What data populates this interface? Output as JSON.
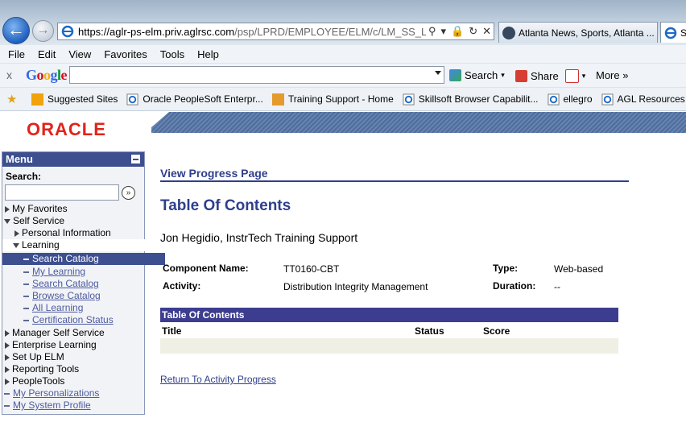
{
  "browser": {
    "url_host": "https://aglr-ps-elm.priv.aglrsc.com",
    "url_path": "/psp/LPRD/EMPLOYEE/ELM/c/LM_SS_LEARNIN",
    "tabs": [
      {
        "label": "Atlanta News, Sports, Atlanta ..."
      },
      {
        "label": "Se"
      }
    ],
    "menu": [
      "File",
      "Edit",
      "View",
      "Favorites",
      "Tools",
      "Help"
    ],
    "google_toolbar": {
      "close": "x",
      "logo": "Google",
      "search_label": "Search",
      "share_label": "Share",
      "more_label": "More »"
    },
    "favorites": [
      "Suggested Sites",
      "Oracle  PeopleSoft Enterpr...",
      "Training Support - Home",
      "Skillsoft Browser Capabilit...",
      "ellegro",
      "AGL Resources - Please"
    ]
  },
  "header": {
    "logo": "ORACLE"
  },
  "menu": {
    "title": "Menu",
    "search_label": "Search:",
    "items": [
      {
        "label": "My Favorites",
        "icon": "triangle-right"
      },
      {
        "label": "Self Service",
        "icon": "triangle-down"
      },
      {
        "label": "Personal Information",
        "icon": "triangle-right"
      },
      {
        "label": "Learning",
        "icon": "triangle-down"
      },
      {
        "label": "Search Catalog",
        "icon": "dash",
        "selected": true
      },
      {
        "label": "My Learning",
        "icon": "dash"
      },
      {
        "label": "Search Catalog",
        "icon": "dash"
      },
      {
        "label": "Browse Catalog",
        "icon": "dash"
      },
      {
        "label": "All Learning",
        "icon": "dash"
      },
      {
        "label": "Certification Status",
        "icon": "dash"
      },
      {
        "label": "Manager Self Service",
        "icon": "triangle-right"
      },
      {
        "label": "Enterprise Learning",
        "icon": "triangle-right"
      },
      {
        "label": "Set Up ELM",
        "icon": "triangle-right"
      },
      {
        "label": "Reporting Tools",
        "icon": "triangle-right"
      },
      {
        "label": "PeopleTools",
        "icon": "triangle-right"
      },
      {
        "label": "My Personalizations",
        "icon": "dash"
      },
      {
        "label": "My System Profile",
        "icon": "dash"
      }
    ]
  },
  "main": {
    "page_heading": "View Progress Page",
    "title": "Table Of Contents",
    "learner": "Jon Hegidio, InstrTech Training Support",
    "fields": {
      "component_label": "Component Name:",
      "component_value": "TT0160-CBT",
      "activity_label": "Activity:",
      "activity_value": "Distribution Integrity Management",
      "type_label": "Type:",
      "type_value": "Web-based",
      "duration_label": "Duration:",
      "duration_value": "--"
    },
    "grid": {
      "title": "Table Of Contents",
      "columns": [
        "Title",
        "Status",
        "Score"
      ]
    },
    "return_link": "Return To Activity Progress"
  }
}
